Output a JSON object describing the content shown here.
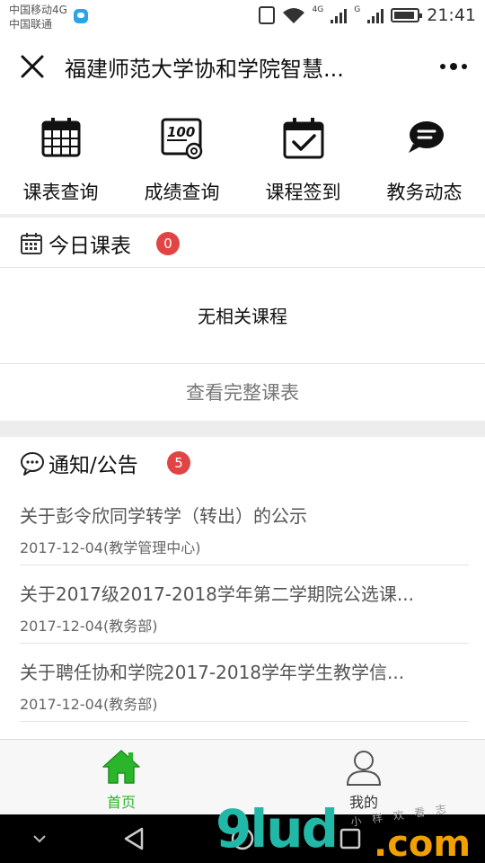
{
  "status_bar": {
    "carrier_1": "中国移动4G",
    "carrier_2": "中国联通",
    "net_label_1": "4G",
    "net_label_2": "G",
    "time": "21:41"
  },
  "title_bar": {
    "title": "福建师范大学协和学院智慧..."
  },
  "quick_menu": [
    {
      "label": "课表查询",
      "icon": "calendar-icon"
    },
    {
      "label": "成绩查询",
      "icon": "score-100-icon"
    },
    {
      "label": "课程签到",
      "icon": "calendar-check-icon"
    },
    {
      "label": "教务动态",
      "icon": "chat-bubble-icon"
    }
  ],
  "today_schedule": {
    "title": "今日课表",
    "badge": "0",
    "empty_text": "无相关课程",
    "view_full": "查看完整课表"
  },
  "notices": {
    "title": "通知/公告",
    "badge": "5",
    "items": [
      {
        "title": "关于彭令欣同学转学（转出）的公示",
        "meta": "2017-12-04(教学管理中心)"
      },
      {
        "title": "关于2017级2017-2018学年第二学期院公选课...",
        "meta": "2017-12-04(教务部)"
      },
      {
        "title": "关于聘任协和学院2017-2018学年学生教学信...",
        "meta": "2017-12-04(教务部)"
      }
    ]
  },
  "tab_bar": {
    "home_label": "首页",
    "mine_label": "我的",
    "active_color": "#2bb52b",
    "inactive_color": "#333333"
  },
  "watermark": {
    "main": "9lud",
    "suffix": ".com",
    "small": "小 样 欢 看 志"
  },
  "colors": {
    "badge": "#e24444",
    "accent_green": "#2bb52b"
  }
}
